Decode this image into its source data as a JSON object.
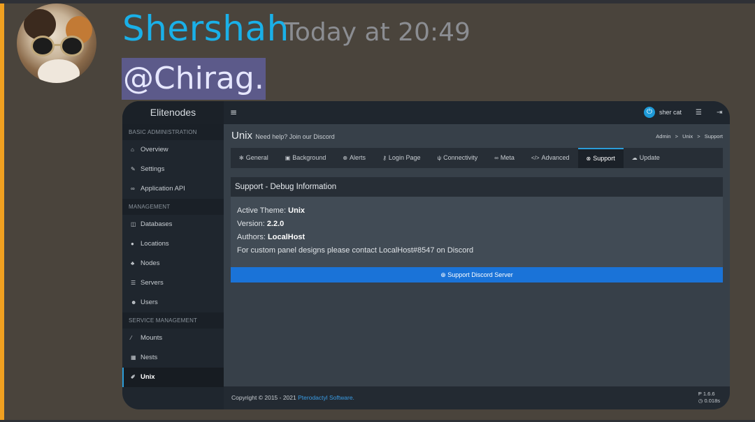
{
  "message": {
    "username": "Shershah",
    "timestamp": "Today at 20:49",
    "mention": "@Chirag."
  },
  "colors": {
    "username": "#1ab0e8",
    "accent_bar": "#f0a020",
    "mention_bg": "#5c5a8a",
    "panel_accent": "#2b9cd8",
    "button": "#1a73d8"
  },
  "panel": {
    "brand": "Elitenodes",
    "topbar": {
      "menu_icon": "hamburger-icon",
      "user": "sher cat",
      "power_icon": "power-icon",
      "list_icon": "server-list-icon",
      "logout_icon": "logout-icon"
    },
    "sidebar": {
      "sections": [
        {
          "title": "BASIC ADMINISTRATION",
          "items": [
            {
              "label": "Overview",
              "icon": "home-icon"
            },
            {
              "label": "Settings",
              "icon": "wrench-icon"
            },
            {
              "label": "Application API",
              "icon": "link-icon"
            }
          ]
        },
        {
          "title": "MANAGEMENT",
          "items": [
            {
              "label": "Databases",
              "icon": "database-icon"
            },
            {
              "label": "Locations",
              "icon": "globe-icon"
            },
            {
              "label": "Nodes",
              "icon": "sitemap-icon"
            },
            {
              "label": "Servers",
              "icon": "server-icon"
            },
            {
              "label": "Users",
              "icon": "users-icon"
            }
          ]
        },
        {
          "title": "SERVICE MANAGEMENT",
          "items": [
            {
              "label": "Mounts",
              "icon": "magic-icon"
            },
            {
              "label": "Nests",
              "icon": "grid-icon"
            },
            {
              "label": "Unix",
              "icon": "brush-icon",
              "active": true
            }
          ]
        }
      ]
    },
    "page": {
      "title": "Unix",
      "subtitle": "Need help? Join our Discord",
      "breadcrumb": [
        "Admin",
        "Unix",
        "Support"
      ],
      "breadcrumb_sep": ">"
    },
    "tabs": [
      {
        "label": "General",
        "icon": "gear-icon"
      },
      {
        "label": "Background",
        "icon": "image-icon"
      },
      {
        "label": "Alerts",
        "icon": "plus-circle-icon"
      },
      {
        "label": "Login Page",
        "icon": "key-icon"
      },
      {
        "label": "Connectivity",
        "icon": "plug-icon"
      },
      {
        "label": "Meta",
        "icon": "link-icon"
      },
      {
        "label": "Advanced",
        "icon": "code-icon"
      },
      {
        "label": "Support",
        "icon": "x-circle-icon",
        "active": true
      },
      {
        "label": "Update",
        "icon": "cloud-download-icon"
      }
    ],
    "debug": {
      "title": "Support - Debug Information",
      "theme_label": "Active Theme:",
      "theme_value": "Unix",
      "version_label": "Version:",
      "version_value": "2.2.0",
      "authors_label": "Authors:",
      "authors_value": "LocalHost",
      "contact_text": "For custom panel designs please contact LocalHost#8547 on Discord",
      "button_label": "Support Discord Server"
    },
    "footer": {
      "copyright": "Copyright © 2015 - 2021",
      "link": "Pterodactyl Software.",
      "version": "1.6.6",
      "time": "0.018s"
    }
  }
}
